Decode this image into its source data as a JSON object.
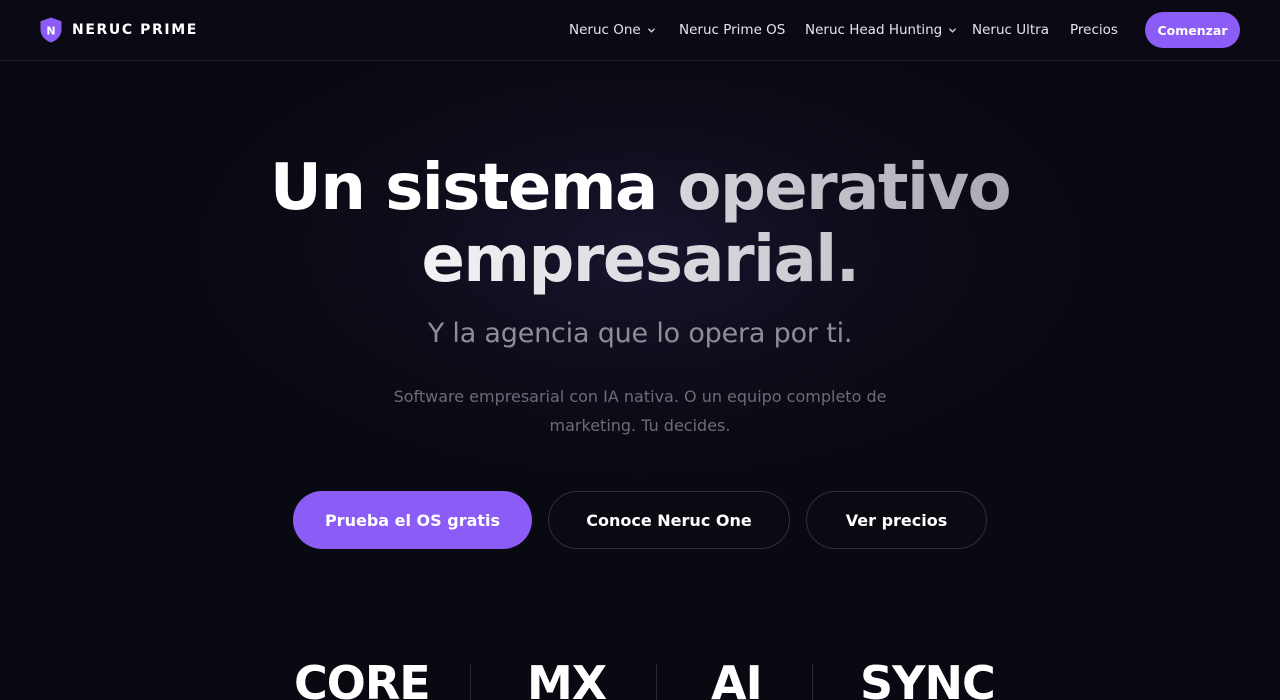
{
  "nav": {
    "brand": "NERUC PRIME",
    "brand_initial": "N",
    "links": [
      {
        "label": "Neruc One",
        "has_dropdown": true,
        "icon": "chevron-down-icon"
      },
      {
        "label": "Neruc Prime OS",
        "has_dropdown": false
      },
      {
        "label": "Neruc Head Hunting",
        "has_dropdown": true,
        "icon": "chevron-down-icon"
      },
      {
        "label": "Neruc Ultra",
        "has_dropdown": false
      },
      {
        "label": "Precios",
        "has_dropdown": false
      }
    ],
    "cta_label": "Comenzar"
  },
  "hero": {
    "title_line1_a": "Un sistema",
    "title_line1_b": "operativo",
    "title_line2": "empresarial.",
    "subtitle": "Y la agencia que lo opera por ti.",
    "description": "Software empresarial con IA nativa. O un equipo completo de marketing. Tu decides."
  },
  "ctas": {
    "primary": "Prueba el OS gratis",
    "secondary": "Conoce Neruc One",
    "tertiary": "Ver precios"
  },
  "stats": [
    "CORE",
    "MX",
    "AI",
    "SYNC"
  ],
  "colors": {
    "accent": "#8b5cf6",
    "background": "#090911"
  }
}
